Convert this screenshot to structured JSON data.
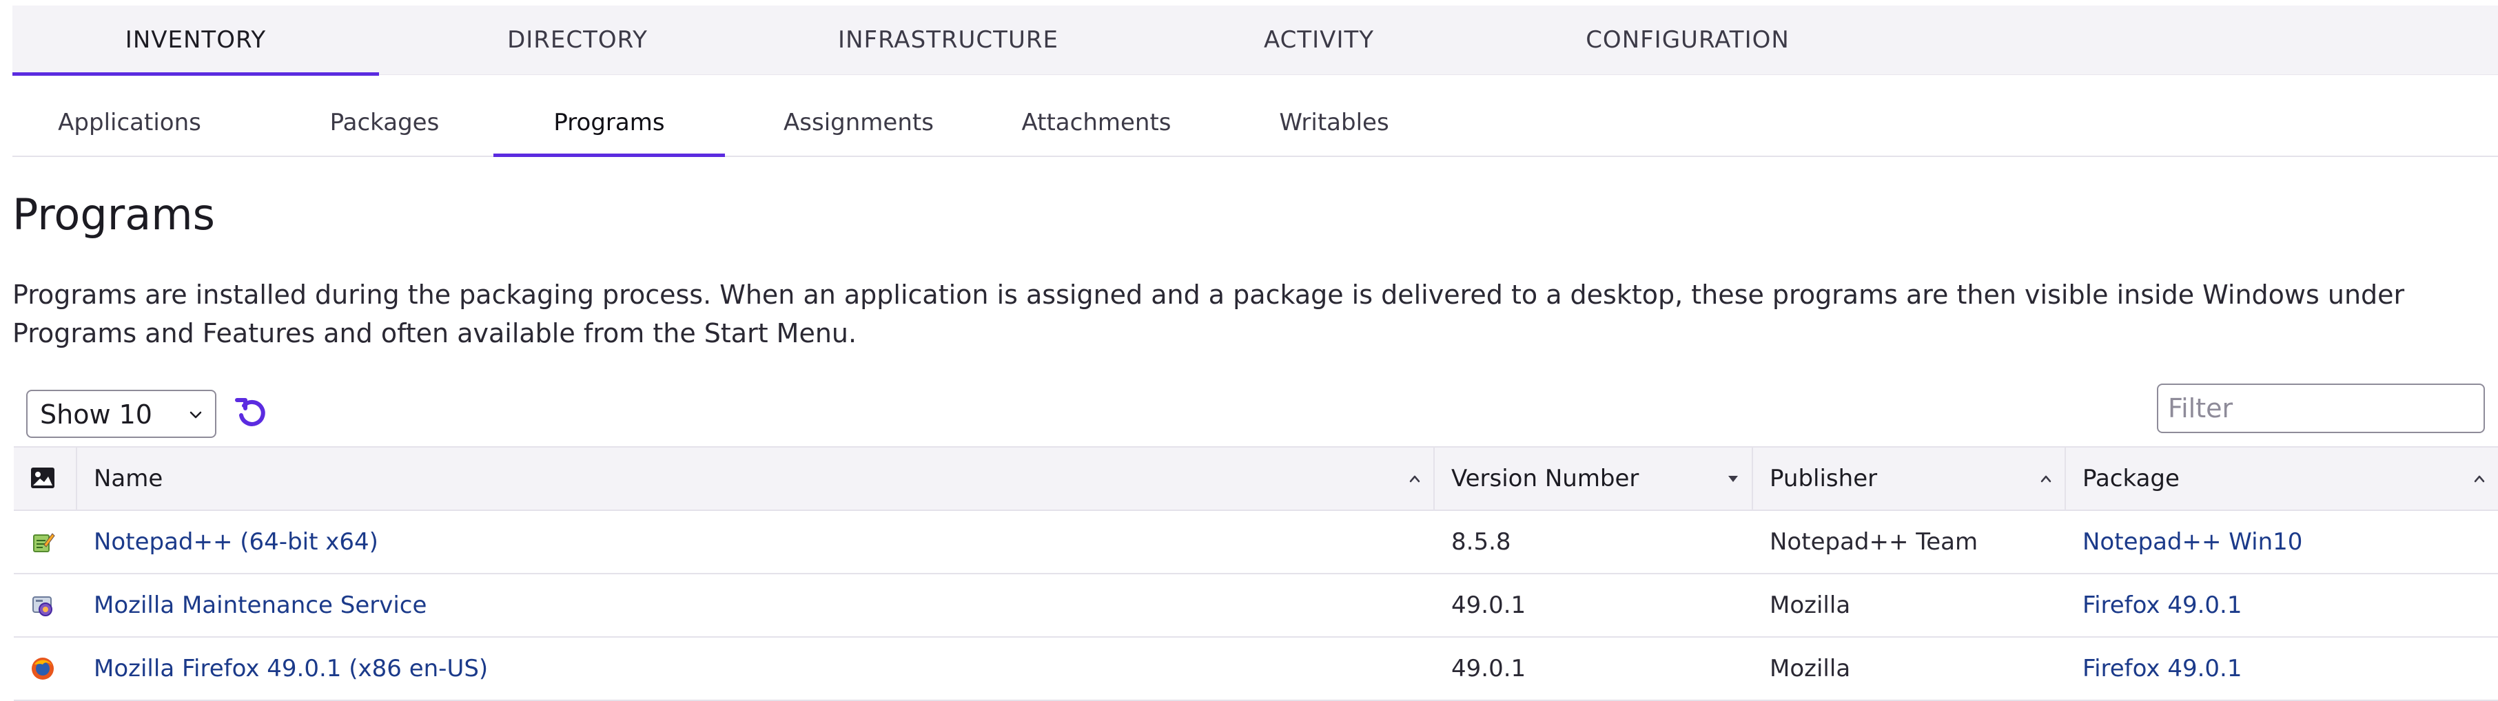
{
  "top_nav": {
    "items": [
      {
        "label": "INVENTORY",
        "active": true
      },
      {
        "label": "DIRECTORY",
        "active": false
      },
      {
        "label": "INFRASTRUCTURE",
        "active": false
      },
      {
        "label": "ACTIVITY",
        "active": false
      },
      {
        "label": "CONFIGURATION",
        "active": false
      }
    ]
  },
  "sub_nav": {
    "items": [
      {
        "label": "Applications",
        "active": false
      },
      {
        "label": "Packages",
        "active": false
      },
      {
        "label": "Programs",
        "active": true
      },
      {
        "label": "Assignments",
        "active": false
      },
      {
        "label": "Attachments",
        "active": false
      },
      {
        "label": "Writables",
        "active": false
      }
    ]
  },
  "page": {
    "title": "Programs",
    "description": "Programs are installed during the packaging process. When an application is assigned and a package is delivered to a desktop, these programs are then visible inside Windows under Programs and Features and often available from the Start Menu."
  },
  "controls": {
    "page_size_value": "Show 10",
    "filter_placeholder": "Filter",
    "filter_value": ""
  },
  "table": {
    "columns": [
      {
        "key": "icon",
        "label": "",
        "icon": "image-icon"
      },
      {
        "key": "name",
        "label": "Name",
        "sort": "asc"
      },
      {
        "key": "version",
        "label": "Version Number",
        "sort": "desc"
      },
      {
        "key": "publisher",
        "label": "Publisher",
        "sort": "asc"
      },
      {
        "key": "package",
        "label": "Package",
        "sort": "asc"
      }
    ],
    "rows": [
      {
        "icon": "notepad-plus-plus-icon",
        "name": "Notepad++ (64-bit x64)",
        "version": "8.5.8",
        "publisher": "Notepad++ Team",
        "package": "Notepad++ Win10"
      },
      {
        "icon": "mozilla-maintenance-icon",
        "name": "Mozilla Maintenance Service",
        "version": "49.0.1",
        "publisher": "Mozilla",
        "package": "Firefox 49.0.1"
      },
      {
        "icon": "firefox-icon",
        "name": "Mozilla Firefox 49.0.1 (x86 en-US)",
        "version": "49.0.1",
        "publisher": "Mozilla",
        "package": "Firefox 49.0.1"
      }
    ]
  },
  "colors": {
    "accent": "#5b2be0",
    "link": "#1b3a8a",
    "header_bg": "#f4f3f7"
  }
}
